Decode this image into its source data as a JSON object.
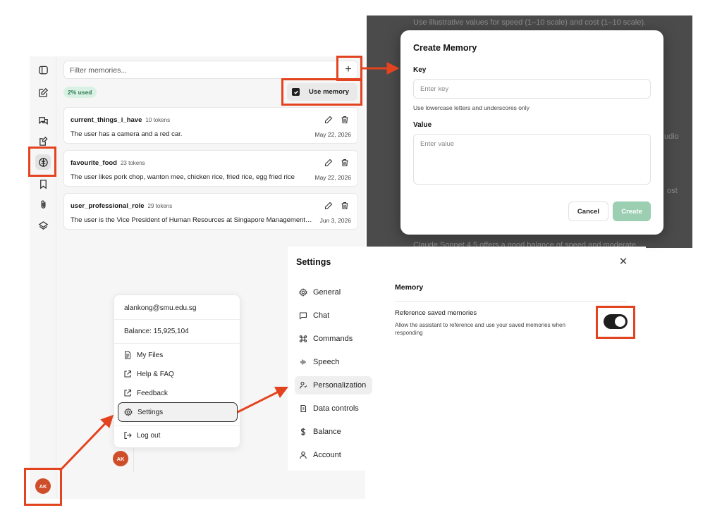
{
  "memory_panel": {
    "filter_placeholder": "Filter memories...",
    "add_icon": "plus-icon",
    "add_label": "+",
    "usage_badge": "2% used",
    "use_memory_label": "Use memory",
    "use_memory_checked": true,
    "items": [
      {
        "key": "current_things_i_have",
        "tokens": "10 tokens",
        "value": "The user has a camera and a red car.",
        "date": "May 22, 2026"
      },
      {
        "key": "favourite_food",
        "tokens": "23 tokens",
        "value": "The user likes pork chop, wanton mee, chicken rice, fried rice, egg fried rice",
        "date": "May 22, 2026"
      },
      {
        "key": "user_professional_role",
        "tokens": "29 tokens",
        "value": "The user is the Vice President of Human Resources at Singapore Management University",
        "date": "Jun 3, 2026"
      }
    ]
  },
  "rail": {
    "icons": [
      "sidebar-toggle-icon",
      "new-chat-icon",
      "chats-icon",
      "prompts-icon",
      "memory-icon",
      "bookmark-icon",
      "attachment-icon",
      "layers-icon"
    ]
  },
  "user_menu": {
    "email": "alankong@smu.edu.sg",
    "balance": "Balance: 15,925,104",
    "items": [
      {
        "label": "My Files",
        "icon": "file-icon"
      },
      {
        "label": "Help & FAQ",
        "icon": "external-link-icon"
      },
      {
        "label": "Feedback",
        "icon": "external-link-icon"
      },
      {
        "label": "Settings",
        "icon": "gear-icon"
      },
      {
        "label": "Log out",
        "icon": "logout-icon"
      }
    ],
    "avatar_initials": "AK"
  },
  "create_memory": {
    "title": "Create Memory",
    "key_label": "Key",
    "key_placeholder": "Enter key",
    "key_hint": "Use lowercase letters and underscores only",
    "value_label": "Value",
    "value_placeholder": "Enter value",
    "cancel_label": "Cancel",
    "create_label": "Create"
  },
  "background_chat": {
    "lines": [
      "Use illustrative values for speed (1–10 scale) and cost (1–10 scale).",
      "udio",
      "ost",
      "Claude Sonnet 4.5 offers a good balance of speed and moderate"
    ]
  },
  "settings": {
    "title": "Settings",
    "close_icon": "close-icon",
    "nav": [
      {
        "label": "General",
        "icon": "gear-icon"
      },
      {
        "label": "Chat",
        "icon": "chat-icon"
      },
      {
        "label": "Commands",
        "icon": "command-icon"
      },
      {
        "label": "Speech",
        "icon": "audio-wave-icon"
      },
      {
        "label": "Personalization",
        "icon": "personalization-icon"
      },
      {
        "label": "Data controls",
        "icon": "data-icon"
      },
      {
        "label": "Balance",
        "icon": "dollar-icon"
      },
      {
        "label": "Account",
        "icon": "user-icon"
      }
    ],
    "active_nav": "Personalization",
    "section_title": "Memory",
    "option_label": "Reference saved memories",
    "option_description": "Allow the assistant to reference and use your saved memories when responding",
    "toggle_on": true
  },
  "colors": {
    "annotation": "#e3431f",
    "accent_green": "#9ccfb2",
    "avatar": "#cf4e2a"
  }
}
